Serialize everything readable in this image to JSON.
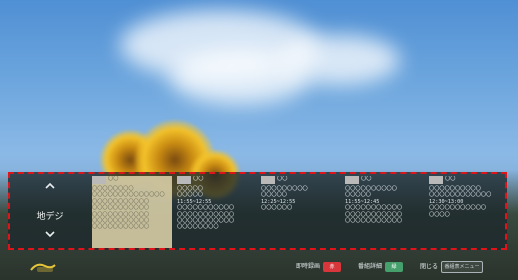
{
  "guide": {
    "channel": {
      "label": "地デジ"
    },
    "programs": [
      {
        "header": "〇〇",
        "subheader": "〇〇〇〇〇〇〇〇",
        "time": "〇〇〇〇〇〇〇〇〇〇〇〇〇〇",
        "lines": [
          "〇〇〇〇〇〇〇〇〇〇〇",
          "〇〇〇〇〇〇〇〇〇〇〇",
          "〇〇〇〇〇〇〇〇〇〇〇",
          "〇〇〇〇〇〇〇〇〇〇〇",
          "〇〇〇〇〇〇〇〇〇〇〇"
        ]
      },
      {
        "header": "〇〇",
        "subheader": "〇〇〇〇〇",
        "title": "〇〇〇〇〇",
        "time": "11:55~12:55",
        "lines": [
          "〇〇〇〇〇〇〇〇〇〇〇",
          "〇〇〇〇〇〇〇〇〇〇〇",
          "〇〇〇〇〇〇〇〇〇〇〇",
          "〇〇〇〇〇〇〇〇"
        ]
      },
      {
        "header": "〇〇",
        "subheader": "〇〇〇〇〇〇〇〇〇",
        "title": "〇〇〇〇〇",
        "time": "12:25~12:55",
        "lines": [
          "〇〇〇〇〇〇"
        ]
      },
      {
        "header": "〇〇",
        "subheader": "〇〇〇〇〇〇〇〇〇〇",
        "title": "〇〇〇〇〇",
        "time": "11:55~12:45",
        "lines": [
          "〇〇〇〇〇〇〇〇〇〇〇",
          "〇〇〇〇〇〇〇〇〇〇〇",
          "〇〇〇〇〇〇〇〇〇〇〇"
        ]
      },
      {
        "header": "〇〇",
        "subheader": "〇〇〇〇〇〇〇〇〇〇",
        "title": "〇〇〇〇〇〇〇〇〇〇〇〇",
        "time": "12:30~13:00",
        "lines": [
          "〇〇〇〇〇〇〇〇〇〇〇",
          "〇〇〇〇"
        ]
      }
    ]
  },
  "footer": {
    "record": {
      "label": "即時録画",
      "key": "赤"
    },
    "details": {
      "label": "番組詳細",
      "key": "緑"
    },
    "close": {
      "label": "閉じる",
      "key": "番組表メニュー"
    }
  },
  "colors": {
    "highlight_border": "#e0121a",
    "red_key": "#d7363b",
    "green_key": "#45a06b"
  }
}
